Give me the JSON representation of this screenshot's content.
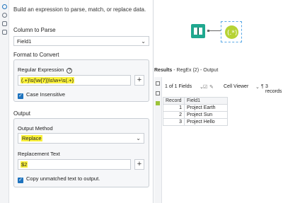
{
  "config": {
    "description": "Build an expression to parse, match, or replace data.",
    "column_to_parse": {
      "title": "Column to Parse",
      "selected": "Field1"
    },
    "format_to_convert": {
      "title": "Format to Convert",
      "regex_label": "Regular Expression",
      "regex_value": "(.+)\\s(\\w{7})\\s\\w+\\s(.+)",
      "case_insensitive": "Case Insensitive"
    },
    "output": {
      "title": "Output",
      "method_label": "Output Method",
      "method_selected": "Replace",
      "replacement_label": "Replacement Text",
      "replacement_value": "$2",
      "copy_unmatched": "Copy unmatched text to output."
    }
  },
  "results": {
    "header_title": "Results",
    "header_sub": "- RegEx (2) - Output",
    "fields_label": "1 of 1 Fields",
    "cell_viewer": "Cell Viewer",
    "records_label": "3 records",
    "columns": [
      "Record",
      "Field1"
    ],
    "rows": [
      [
        "1",
        "Project Earth"
      ],
      [
        "2",
        "Project Sun"
      ],
      [
        "3",
        "Project Hello"
      ]
    ]
  },
  "icons": {
    "input_tool": "book-icon",
    "regex_tool": "regex-icon"
  },
  "colors": {
    "highlight": "#fbf23a",
    "accent": "#1e73be",
    "input_tool": "#1fa88f",
    "regex_tool": "#b6d334"
  }
}
